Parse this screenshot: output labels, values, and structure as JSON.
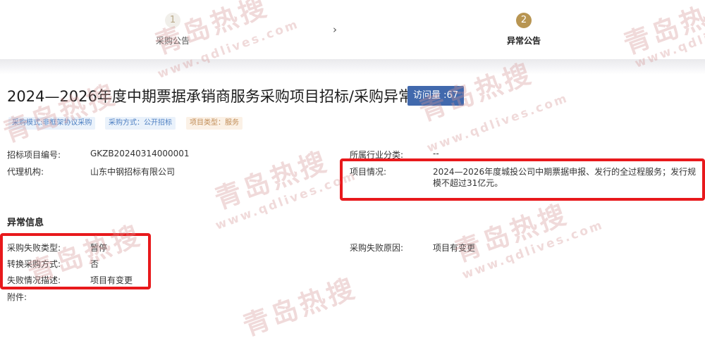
{
  "steps": [
    {
      "number": "1",
      "label": "采购公告"
    },
    {
      "number": "2",
      "label": "异常公告"
    }
  ],
  "step_separator": "›",
  "title": "2024—2026年度中期票据承销商服务采购项目招标/采购异常",
  "visits": "访问量 :67",
  "tags": [
    {
      "text": "采购模式:非框架协议采购",
      "color": "blue"
    },
    {
      "text": "采购方式：公开招标",
      "color": "blue"
    },
    {
      "text": "项目类型：服务",
      "color": "orange"
    }
  ],
  "info": {
    "project_no_label": "招标项目编号:",
    "project_no": "GKZB20240314000001",
    "agency_label": "代理机构:",
    "agency": "山东中钢招标有限公司",
    "industry_label": "所属行业分类:",
    "industry": "--",
    "status_label": "项目情况:",
    "status_line1": "2024—2026年度城投公司中期票据申报、发行的全过程服务；发行规",
    "status_line2": "模不超过31亿元。"
  },
  "exception": {
    "section_title": "异常信息",
    "fail_type_label": "采购失败类型:",
    "fail_type": "暂停",
    "convert_label": "转换采购方式:",
    "convert": "否",
    "desc_label": "失败情况描述:",
    "desc": "项目有变更",
    "reason_label": "采购失败原因:",
    "reason": "项目有变更",
    "attachment_label": "附件:"
  },
  "watermark": {
    "brand": "青岛热搜",
    "url": "www.qdlives.com"
  },
  "colors": {
    "accent_gold": "#b89552",
    "visits_blue": "#4169ad",
    "highlight_red": "#e8191c"
  }
}
